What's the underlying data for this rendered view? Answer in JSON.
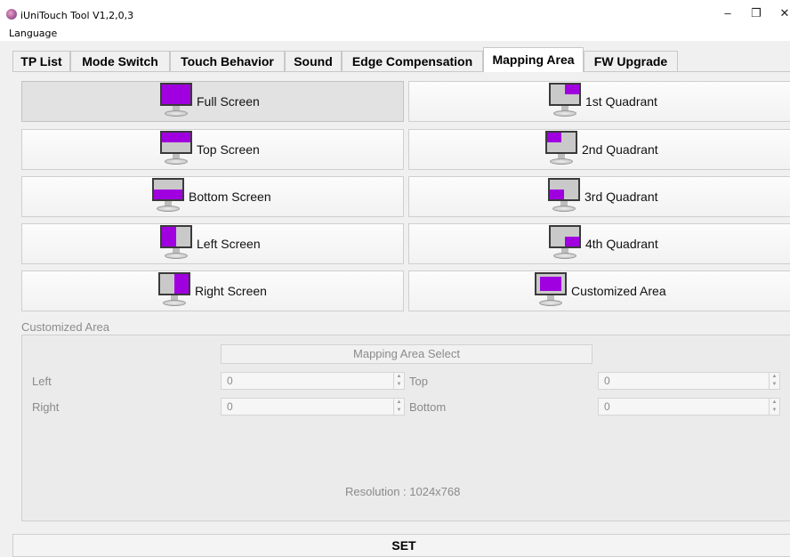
{
  "window": {
    "title": "iUniTouch Tool V1,2,0,3",
    "minimize_glyph": "–",
    "restore_glyph": "❐",
    "close_glyph": "✕"
  },
  "menu": {
    "language": "Language"
  },
  "tabs": [
    {
      "label": "TP List"
    },
    {
      "label": "Mode Switch"
    },
    {
      "label": "Touch Behavior"
    },
    {
      "label": "Sound"
    },
    {
      "label": "Edge Compensation"
    },
    {
      "label": "Mapping Area",
      "active": true
    },
    {
      "label": "FW Upgrade"
    }
  ],
  "mapping_buttons": {
    "left": [
      {
        "label": "Full Screen",
        "icon": "full-screen-monitor-icon",
        "selected": true
      },
      {
        "label": "Top Screen",
        "icon": "top-screen-monitor-icon"
      },
      {
        "label": "Bottom Screen",
        "icon": "bottom-screen-monitor-icon"
      },
      {
        "label": "Left Screen",
        "icon": "left-screen-monitor-icon"
      },
      {
        "label": "Right Screen",
        "icon": "right-screen-monitor-icon"
      }
    ],
    "right": [
      {
        "label": "1st Quadrant",
        "icon": "first-quadrant-monitor-icon"
      },
      {
        "label": "2nd Quadrant",
        "icon": "second-quadrant-monitor-icon"
      },
      {
        "label": "3rd Quadrant",
        "icon": "third-quadrant-monitor-icon"
      },
      {
        "label": "4th Quadrant",
        "icon": "fourth-quadrant-monitor-icon"
      },
      {
        "label": "Customized Area",
        "icon": "customized-area-monitor-icon"
      }
    ]
  },
  "customized_area": {
    "group_label": "Customized Area",
    "select_button": "Mapping Area Select",
    "fields": {
      "left": {
        "label": "Left",
        "value": "0"
      },
      "top": {
        "label": "Top",
        "value": "0"
      },
      "right": {
        "label": "Right",
        "value": "0"
      },
      "bottom": {
        "label": "Bottom",
        "value": "0"
      }
    },
    "resolution": "Resolution : 1024x768"
  },
  "set_button": "SET",
  "colors": {
    "mapping_highlight": "#a000e0",
    "monitor_screen": "#c9c9c9",
    "selected_button": "#e2e2e2"
  }
}
